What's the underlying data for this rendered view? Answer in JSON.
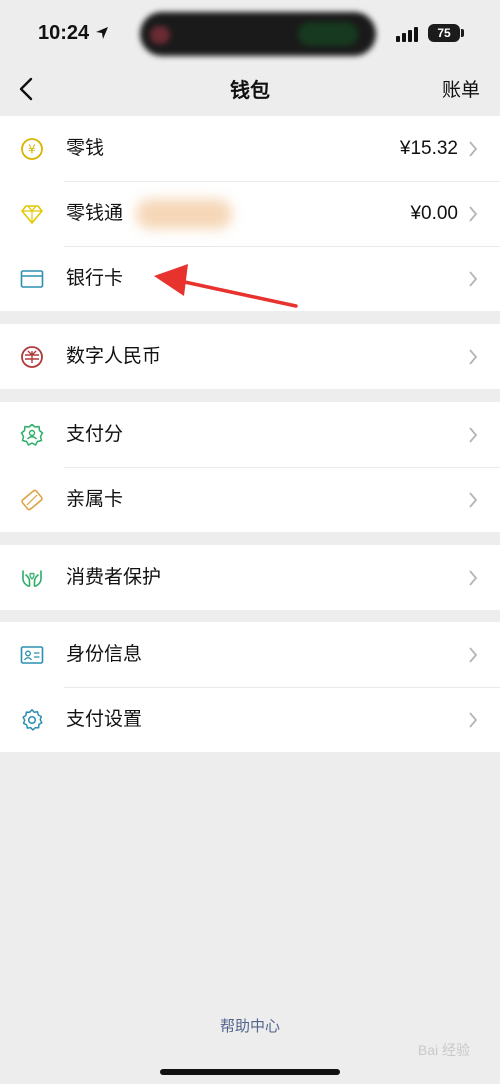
{
  "status": {
    "time": "10:24",
    "battery": "75"
  },
  "nav": {
    "title": "钱包",
    "right": "账单"
  },
  "groups": [
    {
      "items": [
        {
          "label": "零钱",
          "value": "¥15.32",
          "icon": "coin-icon",
          "color": "#d8b400"
        },
        {
          "label": "零钱通",
          "value": "¥0.00",
          "icon": "diamond-icon",
          "color": "#e3c700"
        },
        {
          "label": "银行卡",
          "value": "",
          "icon": "card-icon",
          "color": "#2b8fb3"
        }
      ]
    },
    {
      "items": [
        {
          "label": "数字人民币",
          "value": "",
          "icon": "ecny-icon",
          "color": "#b03a3a"
        }
      ]
    },
    {
      "items": [
        {
          "label": "支付分",
          "value": "",
          "icon": "score-icon",
          "color": "#2aae67"
        },
        {
          "label": "亲属卡",
          "value": "",
          "icon": "family-card-icon",
          "color": "#e0a144"
        }
      ]
    },
    {
      "items": [
        {
          "label": "消费者保护",
          "value": "",
          "icon": "hands-icon",
          "color": "#2aae67"
        }
      ]
    },
    {
      "items": [
        {
          "label": "身份信息",
          "value": "",
          "icon": "id-card-icon",
          "color": "#2b8fb3"
        },
        {
          "label": "支付设置",
          "value": "",
          "icon": "gear-icon",
          "color": "#2b8fb3"
        }
      ]
    }
  ],
  "footer": {
    "help": "帮助中心",
    "watermark": "Bai 经验"
  }
}
